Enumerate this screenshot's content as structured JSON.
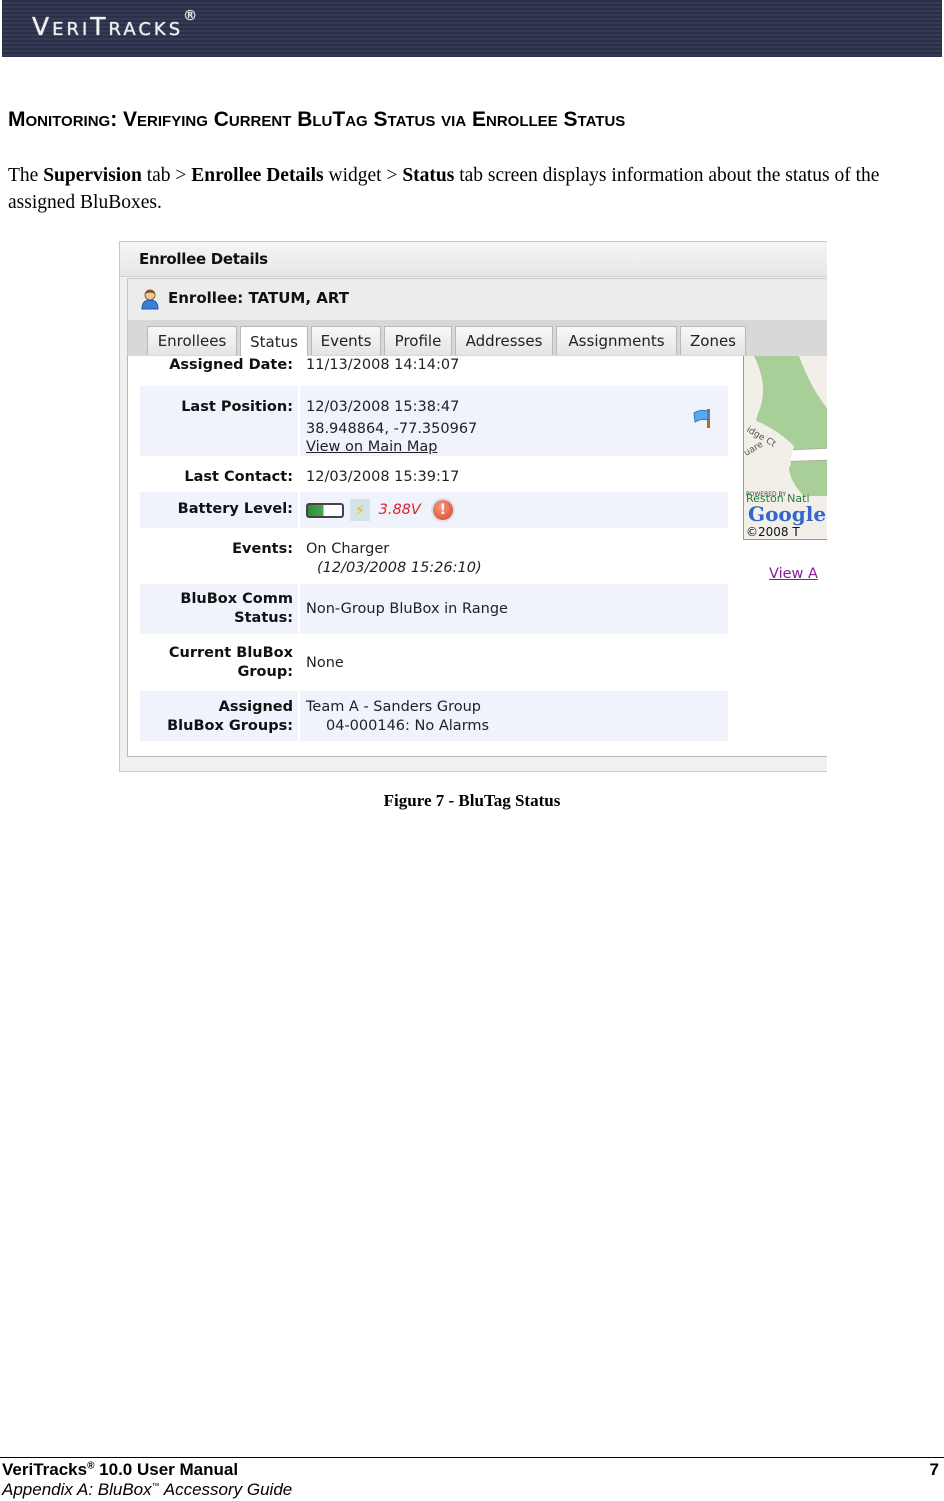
{
  "banner": {
    "logo_text": "VeriTracks",
    "logo_mark": "®"
  },
  "heading": "Monitoring: Verifying Current BluTag Status via Enrollee Status",
  "intro": {
    "p1": "The ",
    "supervision": "Supervision",
    "p2": " tab > ",
    "enrollee_details": "Enrollee Details",
    "p3": " widget > ",
    "status": "Status",
    "p4": " tab screen displays information about the status of the assigned BluBoxes."
  },
  "figure": {
    "widget_title": "Enrollee Details",
    "enrollee_label": "Enrollee: TATUM, ART",
    "tabs": [
      {
        "label": "Enrollees",
        "active": false
      },
      {
        "label": "Status",
        "active": true
      },
      {
        "label": "Events",
        "active": false
      },
      {
        "label": "Profile",
        "active": false
      },
      {
        "label": "Addresses",
        "active": false
      },
      {
        "label": "Assignments",
        "active": false
      },
      {
        "label": "Zones",
        "active": false
      }
    ],
    "rows": {
      "assigned_date": {
        "label": "Assigned Date:",
        "value": "11/13/2008 14:14:07"
      },
      "last_position": {
        "label": "Last Position:",
        "time": "12/03/2008 15:38:47",
        "coords": "38.948864, -77.350967",
        "link": "View on Main Map"
      },
      "last_contact": {
        "label": "Last Contact:",
        "value": "12/03/2008 15:39:17"
      },
      "battery_level": {
        "label": "Battery Level:",
        "value": "3.88V",
        "charge_fraction": 0.45
      },
      "events": {
        "label": "Events:",
        "value": "On Charger",
        "time": "(12/03/2008 15:26:10)"
      },
      "comm_status": {
        "label1": "BluBox Comm",
        "label2": "Status:",
        "value": "Non-Group BluBox in Range"
      },
      "current_group": {
        "label1": "Current BluBox",
        "label2": "Group:",
        "value": "None"
      },
      "assigned_groups": {
        "label1": "Assigned",
        "label2": "BluBox Groups:",
        "value1": "Team A - Sanders Group",
        "value2": "04-000146: No Alarms"
      }
    },
    "map": {
      "copyright": "©2008 T",
      "powered_by": "POWERED BY",
      "google": "Google",
      "street1": "idge Ct",
      "street2": "uare",
      "place": "Reston Nati"
    },
    "view_all_link": "View A"
  },
  "caption": "Figure 7 - BluTag Status",
  "footer": {
    "title": "VeriTracks",
    "title_mark": "®",
    "title_rest": " 10.0 User Manual",
    "subtitle": "Appendix A: BluBox",
    "subtitle_mark": "™",
    "subtitle_rest": " Accessory Guide",
    "page_number": "7"
  }
}
